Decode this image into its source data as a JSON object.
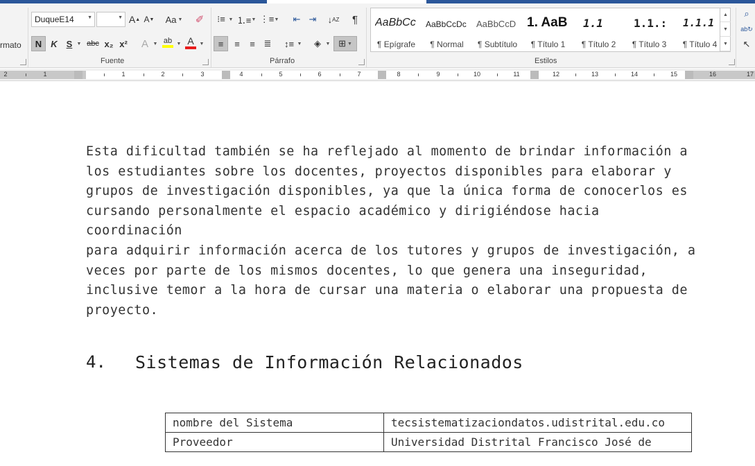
{
  "ribbon": {
    "left_partial_label": "rmato",
    "font": {
      "name": "DuqueE14",
      "size": "",
      "group_label": "Fuente"
    },
    "paragraph": {
      "group_label": "Párrafo"
    },
    "styles": {
      "group_label": "Estilos",
      "items": [
        {
          "sample": "AaBbCc",
          "name": "¶ Epígrafe"
        },
        {
          "sample": "AaBbCcDc",
          "name": "¶ Normal"
        },
        {
          "sample": "AaBbCcD",
          "name": "¶ Subtítulo"
        },
        {
          "sample": "1. AaB",
          "name": "¶ Título 1"
        },
        {
          "sample": "1.1",
          "name": "¶ Título 2"
        },
        {
          "sample": "1.1.:",
          "name": "¶ Título 3"
        },
        {
          "sample": "1.1.1",
          "name": "¶ Título 4"
        }
      ]
    },
    "buttons": {
      "grow_font": "A",
      "shrink_font": "A",
      "change_case": "Aa",
      "bold": "N",
      "italic": "K",
      "underline": "S",
      "strikethrough": "abc",
      "subscript": "x₂",
      "superscript": "x²",
      "text_effects": "A",
      "highlight": "ab",
      "font_color": "A",
      "pilcrow": "¶"
    },
    "ruler_numbers": [
      "2",
      "1",
      "1",
      "2",
      "3",
      "4",
      "5",
      "6",
      "7",
      "8",
      "9",
      "10",
      "11",
      "12",
      "13",
      "14",
      "15",
      "16",
      "17"
    ]
  },
  "document": {
    "paragraph": "Esta dificultad también se ha reflejado al momento de brindar información a\nlos estudiantes sobre los docentes, proyectos disponibles para elaborar y\ngrupos de investigación disponibles, ya que la única forma de conocerlos es\ncursando personalmente el espacio académico y dirigiéndose hacia coordinación\npara adquirir información acerca de los tutores y grupos de investigación, a\nveces por parte de los mismos docentes, lo que genera una inseguridad,\ninclusive temor a la hora de cursar una materia o elaborar una propuesta de\nproyecto.",
    "heading_number": "4.",
    "heading_title": "Sistemas de Información Relacionados",
    "table": [
      {
        "label": "nombre del Sistema",
        "value": "tecsistematizaciondatos.udistrital.edu.co"
      },
      {
        "label": "Proveedor",
        "value": "Universidad Distrital Francisco José de"
      }
    ]
  },
  "colors": {
    "ribbon_bg": "#f3f3f3",
    "title_bar": "#2b579a",
    "font_color_red": "#e81c1c",
    "highlight_yellow": "#ffff00"
  }
}
